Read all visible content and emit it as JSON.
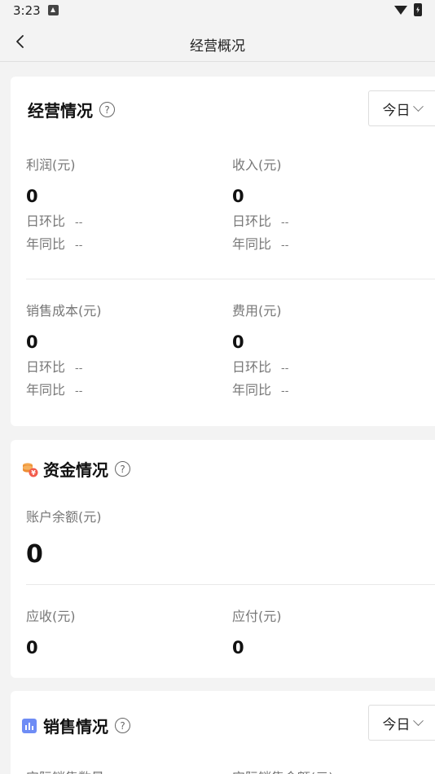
{
  "status_bar": {
    "time": "3:23"
  },
  "nav": {
    "title": "经营概况"
  },
  "business": {
    "title": "经营情况",
    "help": "?",
    "period": "今日",
    "metrics": [
      {
        "label": "利润(元)",
        "value": "0",
        "day_label": "日环比",
        "day_value": "--",
        "year_label": "年同比",
        "year_value": "--"
      },
      {
        "label": "收入(元)",
        "value": "0",
        "day_label": "日环比",
        "day_value": "--",
        "year_label": "年同比",
        "year_value": "--"
      },
      {
        "label": "销售成本(元)",
        "value": "0",
        "day_label": "日环比",
        "day_value": "--",
        "year_label": "年同比",
        "year_value": "--"
      },
      {
        "label": "费用(元)",
        "value": "0",
        "day_label": "日环比",
        "day_value": "--",
        "year_label": "年同比",
        "year_value": "--"
      }
    ]
  },
  "funds": {
    "title": "资金情况",
    "help": "?",
    "balance_label": "账户余额(元)",
    "balance_value": "0",
    "receivable_label": "应收(元)",
    "receivable_value": "0",
    "payable_label": "应付(元)",
    "payable_value": "0"
  },
  "sales": {
    "title": "销售情况",
    "help": "?",
    "period": "今日",
    "col1_label": "实际销售数量",
    "col2_label": "实际销售金额(元)"
  },
  "colors": {
    "fund_icon": "#f39a3c",
    "sales_icon": "#6e8cf5"
  }
}
